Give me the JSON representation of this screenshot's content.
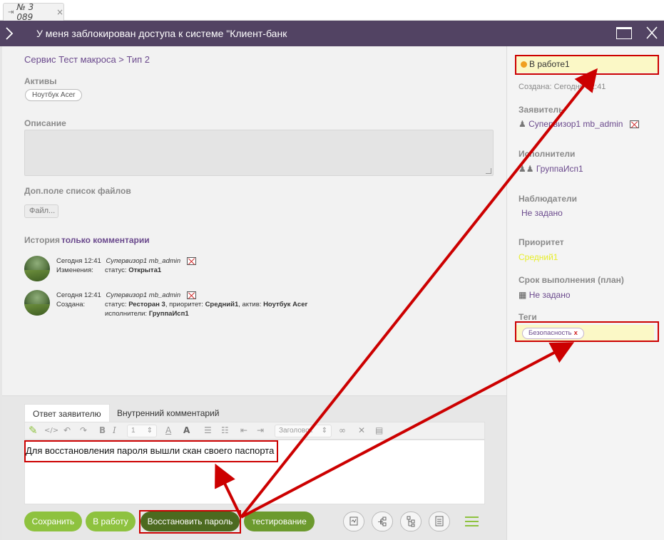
{
  "tab": {
    "label": "№ 3 089"
  },
  "window": {
    "title": "У меня заблокирован доступа к системе \"Клиент-банк"
  },
  "main": {
    "breadcrumb": "Сервис Тест макроса > Тип 2",
    "assets_label": "Активы",
    "asset_pill": "Ноутбук Acer",
    "description_label": "Описание",
    "files_label": "Доп.поле список файлов",
    "file_button": "Файл...",
    "history_label": "История",
    "history_link": "только комментарии",
    "history": [
      {
        "time": "Сегодня 12:41",
        "author": "Супервизор1 mb_admin",
        "kind": "Изменения:",
        "line1_prefix": "статус: ",
        "line1_status": "Открыта1"
      },
      {
        "time": "Сегодня 12:41",
        "author": "Супервизор1 mb_admin",
        "kind": "Создана:",
        "line1_a": "статус: ",
        "line1_b": "Ресторан 3",
        "line1_c": ", приоритет: ",
        "line1_d": "Средний1",
        "line1_e": ", актив: ",
        "line1_f": "Ноутбук Acer",
        "line2_a": "исполнители: ",
        "line2_b": "ГруппаИсп1"
      }
    ]
  },
  "editor": {
    "tab_reply": "Ответ заявителю",
    "tab_internal": "Внутренний комментарий",
    "font_size": "1",
    "heading_select": "Заголовок",
    "text": "Для восстановления пароля вышли скан своего паспорта"
  },
  "buttons": {
    "save": "Сохранить",
    "to_work": "В работу",
    "restore_password": "Восстановить пароль",
    "testing": "тестирование"
  },
  "sidebar": {
    "status": "В работе1",
    "created_label": "Создана:",
    "created_value": "Сегодня 12:41",
    "requester_label": "Заявитель",
    "requester": "Супервизор1 mb_admin",
    "assignees_label": "Исполнители",
    "assignees": "ГруппаИсп1",
    "watchers_label": "Наблюдатели",
    "watchers": "Не задано",
    "priority_label": "Приоритет",
    "priority": "Средний1",
    "due_label": "Срок выполнения (план)",
    "due": "Не задано",
    "tags_label": "Теги",
    "tag": "Безопасность"
  },
  "colors": {
    "title_bar": "#524363",
    "link": "#6b4a8d",
    "button_light": "#8ec23f",
    "button_dark": "#4c6a1f",
    "priority": "#e7ee2a",
    "status_dot": "#f0a020",
    "annotation": "#cc0000"
  }
}
